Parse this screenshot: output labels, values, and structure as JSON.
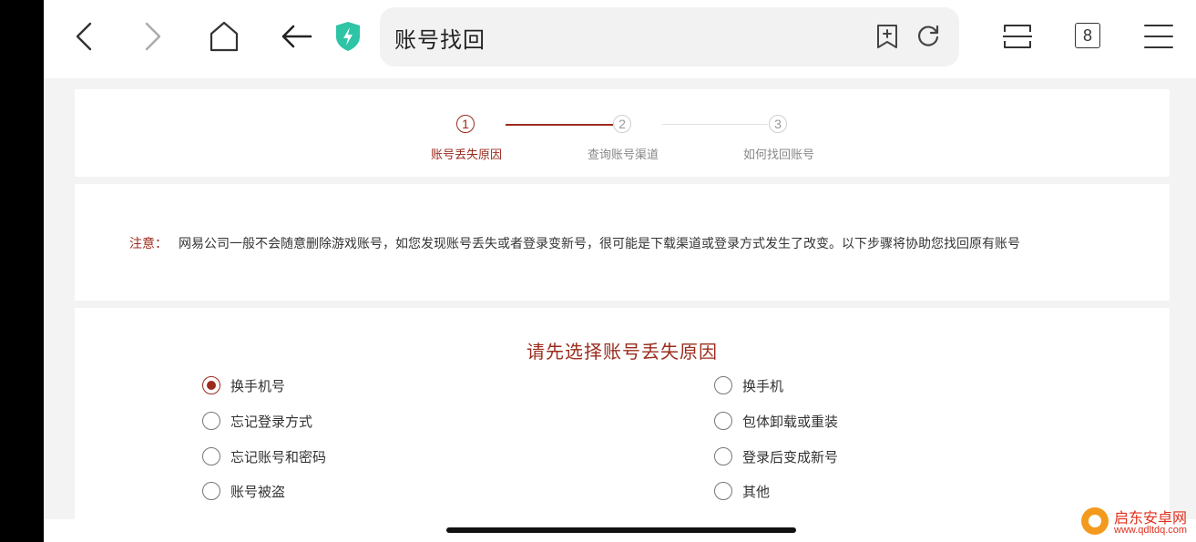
{
  "browser": {
    "address_title": "账号找回",
    "tab_count": "8",
    "icons": {
      "back": "chevron-left-icon",
      "forward": "chevron-right-icon",
      "home": "home-icon",
      "return": "arrow-left-icon",
      "shield": "shield-bolt-icon",
      "bookmark": "bookmark-add-icon",
      "reload": "reload-icon",
      "reader": "reader-mode-icon",
      "menu": "hamburger-menu-icon"
    },
    "shield_color": "#2ec4a6"
  },
  "steps": [
    {
      "number": "1",
      "label": "账号丢失原因",
      "active": true
    },
    {
      "number": "2",
      "label": "查询账号渠道",
      "active": false
    },
    {
      "number": "3",
      "label": "如何找回账号",
      "active": false
    }
  ],
  "notice": {
    "label": "注意：",
    "text": "网易公司一般不会随意删除游戏账号，如您发现账号丢失或者登录变新号，很可能是下载渠道或登录方式发生了改变。以下步骤将协助您找回原有账号"
  },
  "options_section": {
    "title": "请先选择账号丢失原因",
    "options": [
      {
        "label": "换手机号",
        "checked": true
      },
      {
        "label": "换手机",
        "checked": false
      },
      {
        "label": "忘记登录方式",
        "checked": false
      },
      {
        "label": "包体卸载或重装",
        "checked": false
      },
      {
        "label": "忘记账号和密码",
        "checked": false
      },
      {
        "label": "登录后变成新号",
        "checked": false
      },
      {
        "label": "账号被盗",
        "checked": false
      },
      {
        "label": "其他",
        "checked": false
      }
    ]
  },
  "watermark": {
    "name": "启东安卓网",
    "url": "www.qdltdq.com"
  },
  "colors": {
    "accent": "#9b2c1e",
    "page_bg": "#f3f3f3"
  }
}
